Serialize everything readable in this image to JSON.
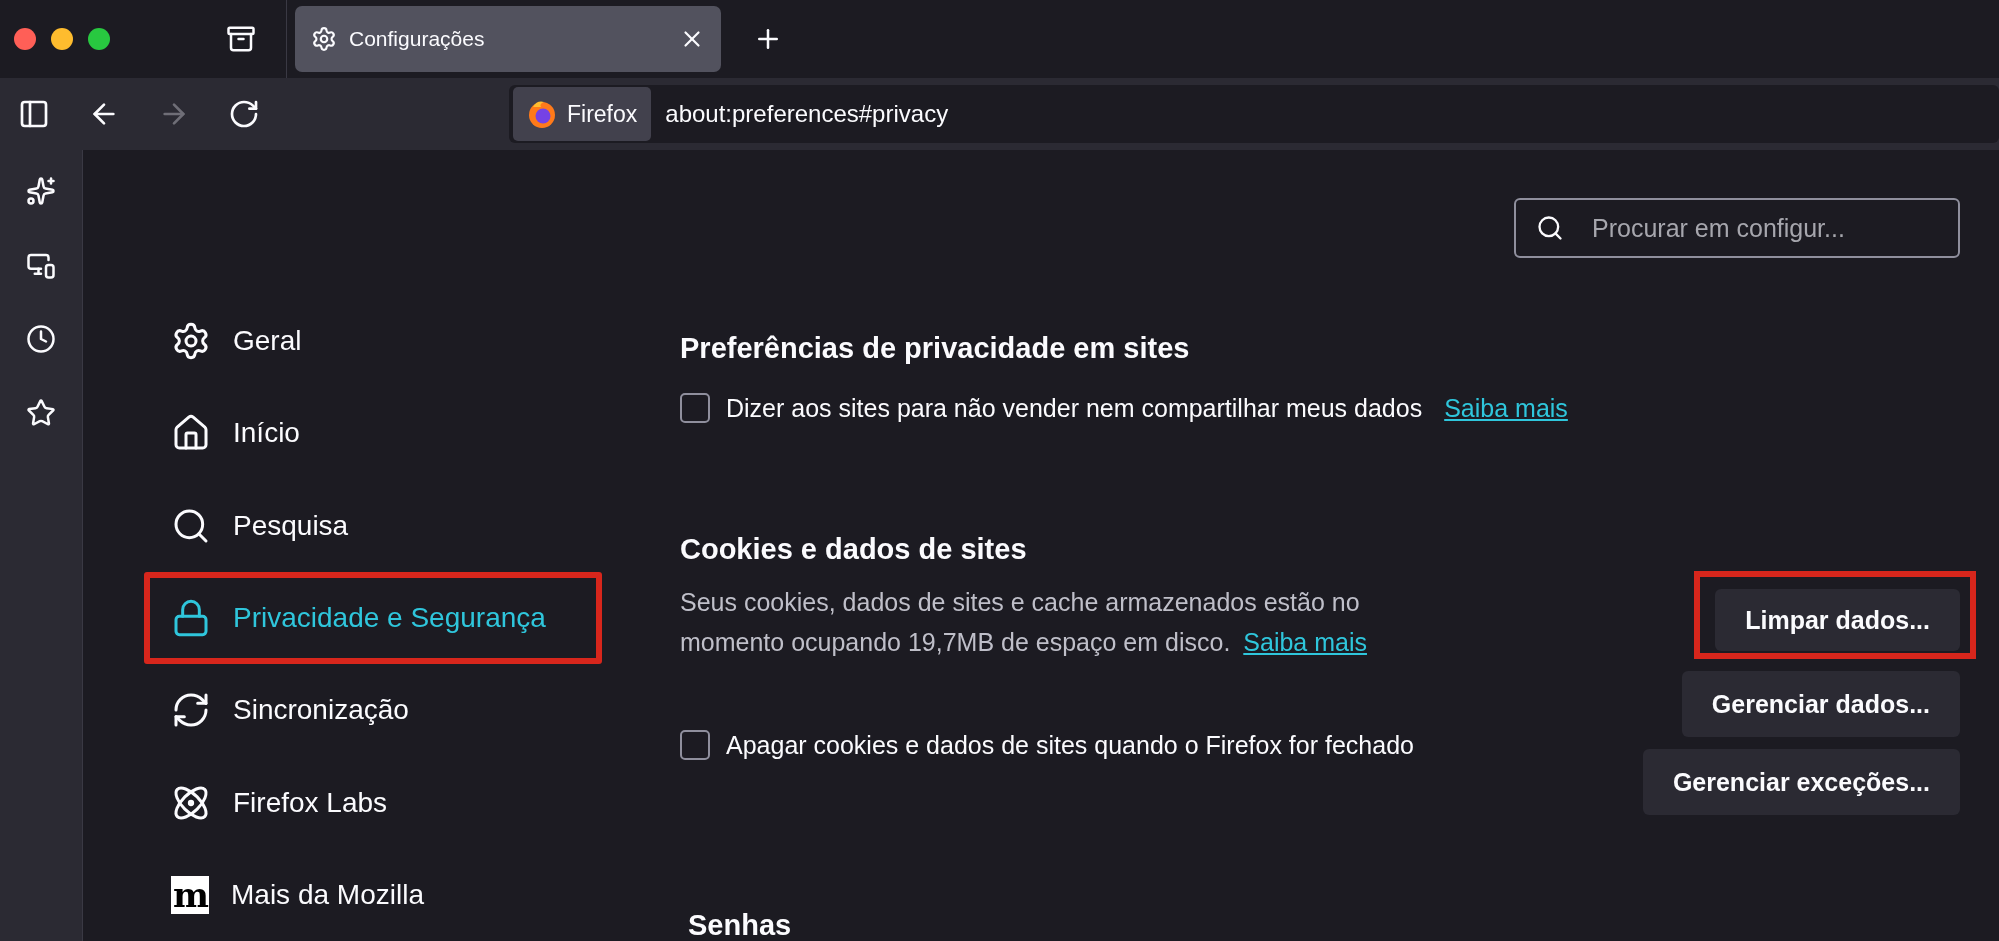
{
  "window_controls": [
    {
      "color": "#ff5f57"
    },
    {
      "color": "#febc2e"
    },
    {
      "color": "#28c840"
    }
  ],
  "tabs": [
    {
      "label": "Configurações",
      "selected": true
    }
  ],
  "toolbar": {
    "buttons": [
      {
        "kind": "sidebar",
        "disabled": false
      },
      {
        "kind": "back",
        "disabled": false
      },
      {
        "kind": "forward",
        "disabled": true
      },
      {
        "kind": "reload",
        "disabled": false
      }
    ],
    "identity": "Firefox",
    "url": "about:preferences#privacy"
  },
  "sidebar_tools": [
    {
      "kind": "sparkle"
    },
    {
      "kind": "devices"
    },
    {
      "kind": "history"
    },
    {
      "kind": "star"
    }
  ],
  "search": {
    "placeholder": "Procurar em configur..."
  },
  "nav": [
    {
      "label": "Geral",
      "kind": "gear",
      "selected": false,
      "highlighted": false
    },
    {
      "label": "Início",
      "kind": "home",
      "selected": false,
      "highlighted": false
    },
    {
      "label": "Pesquisa",
      "kind": "search",
      "selected": false,
      "highlighted": false
    },
    {
      "label": "Privacidade e Segurança",
      "kind": "lock",
      "selected": true,
      "highlighted": true
    },
    {
      "label": "Sincronização",
      "kind": "sync",
      "selected": false,
      "highlighted": false
    },
    {
      "label": "Firefox Labs",
      "kind": "atom",
      "selected": false,
      "highlighted": false
    },
    {
      "label": "Mais da Mozilla",
      "kind": "logo",
      "logo": "m",
      "selected": false,
      "highlighted": false
    }
  ],
  "privacy_prefs": {
    "heading": "Preferências de privacidade em sites",
    "option": {
      "label": "Dizer aos sites para não vender nem compartilhar meus dados",
      "checked": false,
      "link": "Saiba mais"
    }
  },
  "cookies": {
    "heading": "Cookies e dados de sites",
    "description": "Seus cookies, dados de sites e cache armazenados estão no momento ocupando 19,7MB de espaço em disco.",
    "link": "Saiba mais",
    "option": {
      "label": "Apagar cookies e dados de sites quando o Firefox for fechado",
      "checked": false
    },
    "buttons": [
      {
        "label": "Limpar dados...",
        "highlighted": true
      },
      {
        "label": "Gerenciar dados...",
        "highlighted": false
      },
      {
        "label": "Gerenciar exceções...",
        "highlighted": false
      }
    ]
  },
  "next_section": {
    "heading": "Senhas"
  }
}
